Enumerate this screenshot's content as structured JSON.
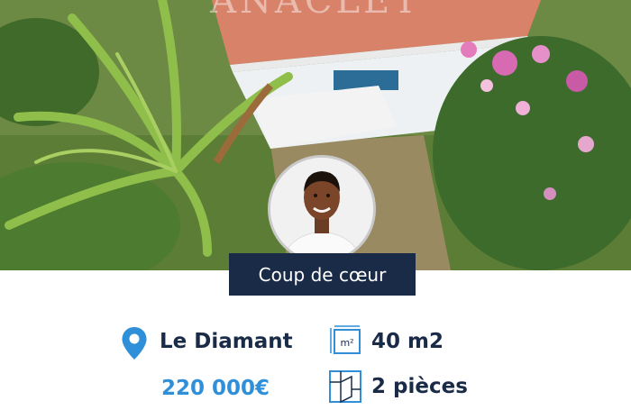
{
  "hero": {
    "watermark_text": "ANACLET",
    "image_description_icon": "aerial-house-photo"
  },
  "badge": {
    "label": "Coup de cœur"
  },
  "listing": {
    "location": "Le Diamant",
    "price": "220 000€",
    "area": "40 m2",
    "area_icon_label": "m²",
    "rooms": "2 pièces"
  },
  "colors": {
    "navy": "#1a2b48",
    "accent_blue": "#2f8fd8",
    "icon_blue": "#2f8fd8"
  },
  "icons": {
    "location": "location-pin-icon",
    "area": "area-icon",
    "rooms": "rooms-icon"
  }
}
